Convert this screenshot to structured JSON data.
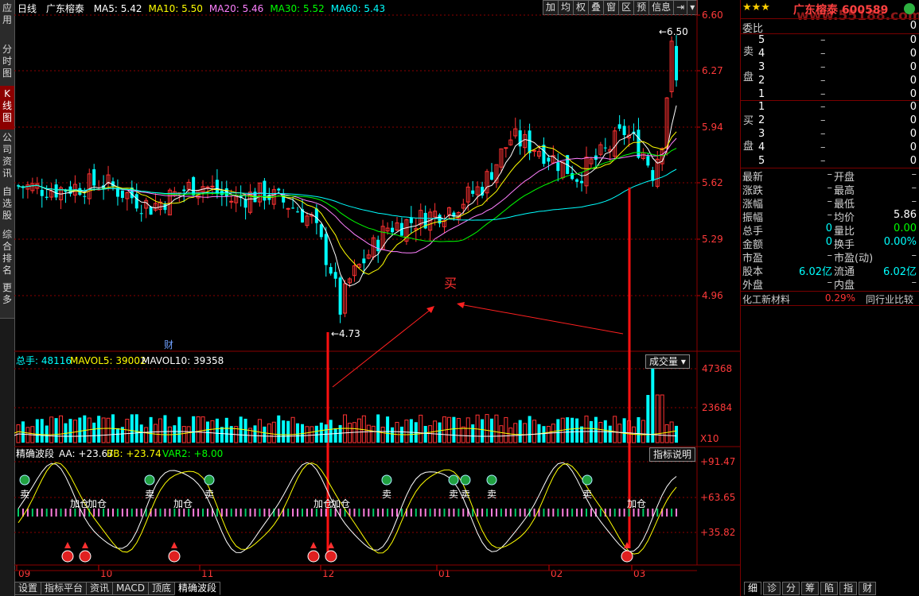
{
  "left_tabs": [
    {
      "label": "应\n用",
      "active": false
    },
    {
      "label": "分\n时\n图",
      "active": false
    },
    {
      "label": "K\n线\n图",
      "active": true
    },
    {
      "label": "公\n司\n资\n讯",
      "active": false
    },
    {
      "label": "自\n选\n股",
      "active": false
    },
    {
      "label": "综\n合\n排\n名",
      "active": false
    },
    {
      "label": "更\n多",
      "active": false
    }
  ],
  "header": {
    "period": "日线",
    "name": "广东榕泰",
    "ma": [
      {
        "label": "MA5: 5.42",
        "color": "#ffffff"
      },
      {
        "label": "MA10: 5.50",
        "color": "#ffff00"
      },
      {
        "label": "MA20: 5.46",
        "color": "#ff80ff"
      },
      {
        "label": "MA30: 5.52",
        "color": "#00ff00"
      },
      {
        "label": "MA60: 5.43",
        "color": "#00ffff"
      }
    ]
  },
  "toolbar": [
    "加",
    "均",
    "权",
    "叠",
    "窗",
    "区",
    "预",
    "信息",
    "⇥",
    "▾"
  ],
  "price_axis": [
    "6.60",
    "6.27",
    "5.94",
    "5.62",
    "5.29",
    "4.96"
  ],
  "price_annotations": {
    "high": "6.50",
    "low": "4.73",
    "cai": "财",
    "buy": "买"
  },
  "volume_header": {
    "total": "总手: 48116",
    "mavol5": "MAVOL5: 39002",
    "mavol10": "MAVOL10: 39358",
    "selector": "成交量 ▾"
  },
  "volume_axis": [
    "47368",
    "23684",
    "X10"
  ],
  "indicator_header": {
    "name": "精确波段",
    "aa": "AA: +23.67",
    "bb": "BB: +23.74",
    "var2": "VAR2: +8.00",
    "help": "指标说明"
  },
  "indicator_axis": [
    "+91.47",
    "+63.65",
    "+35.82"
  ],
  "signals": {
    "sell": "卖",
    "add": "加仓"
  },
  "date_axis": [
    "09",
    "10",
    "11",
    "12",
    "01",
    "02",
    "03"
  ],
  "bottom_tabs": [
    {
      "label": "设置",
      "active": false
    },
    {
      "label": "指标平台",
      "active": false
    },
    {
      "label": "资讯",
      "active": false
    },
    {
      "label": "MACD",
      "active": false
    },
    {
      "label": "顶底",
      "active": false
    },
    {
      "label": "精确波段",
      "active": true
    }
  ],
  "right_panel": {
    "title": "广东榕泰 600589",
    "watermark": "www.55188.com",
    "weibi_label": "委比",
    "weibi_value": "0",
    "sell_side": "卖\n\n盘",
    "buy_side": "买\n\n盘",
    "sell_rows": [
      {
        "n": "5",
        "p": "–",
        "v": "0"
      },
      {
        "n": "4",
        "p": "–",
        "v": "0"
      },
      {
        "n": "3",
        "p": "–",
        "v": "0"
      },
      {
        "n": "2",
        "p": "–",
        "v": "0"
      },
      {
        "n": "1",
        "p": "–",
        "v": "0"
      }
    ],
    "buy_rows": [
      {
        "n": "1",
        "p": "–",
        "v": "0"
      },
      {
        "n": "2",
        "p": "–",
        "v": "0"
      },
      {
        "n": "3",
        "p": "–",
        "v": "0"
      },
      {
        "n": "4",
        "p": "–",
        "v": "0"
      },
      {
        "n": "5",
        "p": "–",
        "v": "0"
      }
    ],
    "quote_rows": [
      {
        "l1": "最新",
        "v1": "–",
        "l2": "开盘",
        "v2": "–",
        "c2": "#c0c0c0"
      },
      {
        "l1": "涨跌",
        "v1": "–",
        "l2": "最高",
        "v2": "–",
        "c2": "#c0c0c0"
      },
      {
        "l1": "涨幅",
        "v1": "–",
        "l2": "最低",
        "v2": "–",
        "c2": "#c0c0c0"
      },
      {
        "l1": "振幅",
        "v1": "–",
        "l2": "均价",
        "v2": "5.86",
        "c2": "#ffffff"
      },
      {
        "l1": "总手",
        "v1": "0",
        "l2": "量比",
        "v2": "0.00",
        "c2": "#00ff00",
        "c1": "#00ffff"
      },
      {
        "l1": "金额",
        "v1": "0",
        "l2": "换手",
        "v2": "0.00%",
        "c2": "#00ffff",
        "c1": "#00ffff"
      },
      {
        "l1": "市盈",
        "v1": "–",
        "l2": "市盈(动)",
        "v2": "–",
        "c2": "#c0c0c0"
      },
      {
        "l1": "股本",
        "v1": "6.02亿",
        "l2": "流通",
        "v2": "6.02亿",
        "c2": "#00ffff",
        "c1": "#00ffff"
      },
      {
        "l1": "外盘",
        "v1": "–",
        "l2": "内盘",
        "v2": "–",
        "c2": "#c0c0c0"
      }
    ],
    "industry": "化工新材料",
    "industry_change": "0.29%",
    "compare": "同行业比较",
    "bottom_tabs": [
      "细",
      "诊",
      "分",
      "筹",
      "陷",
      "指",
      "财"
    ]
  },
  "colors": {
    "up": "#ff3232",
    "down": "#00ffff",
    "grid": "#8c0000",
    "text": "#c0c0c0"
  }
}
